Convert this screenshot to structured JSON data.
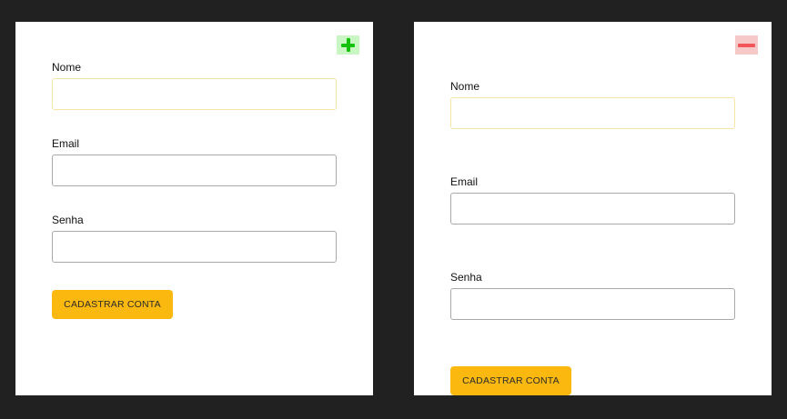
{
  "forms": [
    {
      "toggle_icon": "plus-icon",
      "toggle_color": "#14c20c",
      "fields": [
        {
          "label": "Nome",
          "value": "",
          "placeholder": ""
        },
        {
          "label": "Email",
          "value": "",
          "placeholder": ""
        },
        {
          "label": "Senha",
          "value": "",
          "placeholder": ""
        }
      ],
      "submit_label": "CADASTRAR CONTA"
    },
    {
      "toggle_icon": "minus-icon",
      "toggle_color": "#f2555a",
      "fields": [
        {
          "label": "Nome",
          "value": "",
          "placeholder": ""
        },
        {
          "label": "Email",
          "value": "",
          "placeholder": ""
        },
        {
          "label": "Senha",
          "value": "",
          "placeholder": ""
        }
      ],
      "submit_label": "CADASTRAR CONTA"
    }
  ],
  "colors": {
    "background": "#212121",
    "accent": "#fbb80f",
    "focus_border": "#f8e5a6"
  }
}
